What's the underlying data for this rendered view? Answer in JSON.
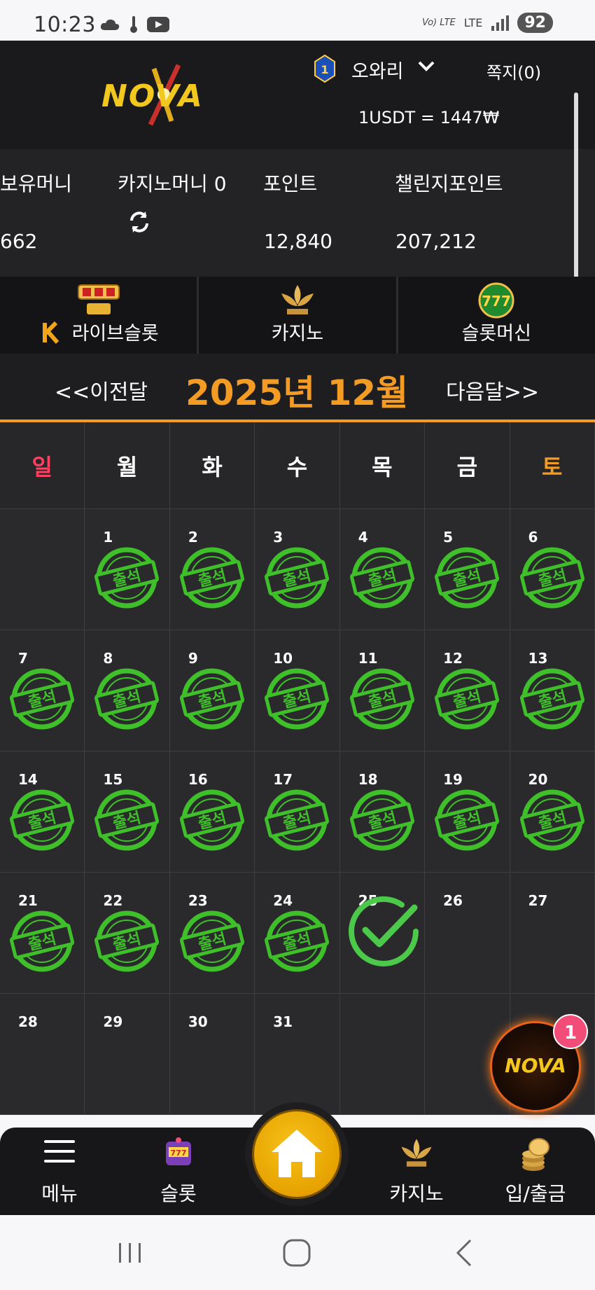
{
  "status_bar": {
    "time": "10:23",
    "battery": "92",
    "network": "LTE",
    "volte": "Vo) LTE"
  },
  "header": {
    "logo": "NOVA",
    "user_name": "오와리",
    "message": "쪽지(0)",
    "rate": "1USDT = 1447₩",
    "rank_level": "1"
  },
  "balances": {
    "holding_label": "보유머니",
    "holding_value": "662",
    "casino_label": "카지노머니 0",
    "point_label": "포인트",
    "point_value": "12,840",
    "challenge_label": "챌린지포인트",
    "challenge_value": "207,212"
  },
  "game_tabs": [
    "라이브슬롯",
    "카지노",
    "슬롯머신"
  ],
  "month_nav": {
    "prev": "<<이전달",
    "title": "2025년 12월",
    "next": "다음달>>"
  },
  "calendar": {
    "weekdays": [
      "일",
      "월",
      "화",
      "수",
      "목",
      "금",
      "토"
    ],
    "stamp_text": "출석",
    "weeks": [
      [
        {
          "d": "",
          "s": "none"
        },
        {
          "d": "1",
          "s": "stamp"
        },
        {
          "d": "2",
          "s": "stamp"
        },
        {
          "d": "3",
          "s": "stamp"
        },
        {
          "d": "4",
          "s": "stamp"
        },
        {
          "d": "5",
          "s": "stamp"
        },
        {
          "d": "6",
          "s": "stamp"
        }
      ],
      [
        {
          "d": "7",
          "s": "stamp"
        },
        {
          "d": "8",
          "s": "stamp"
        },
        {
          "d": "9",
          "s": "stamp"
        },
        {
          "d": "10",
          "s": "stamp"
        },
        {
          "d": "11",
          "s": "stamp"
        },
        {
          "d": "12",
          "s": "stamp"
        },
        {
          "d": "13",
          "s": "stamp"
        }
      ],
      [
        {
          "d": "14",
          "s": "stamp"
        },
        {
          "d": "15",
          "s": "stamp"
        },
        {
          "d": "16",
          "s": "stamp"
        },
        {
          "d": "17",
          "s": "stamp"
        },
        {
          "d": "18",
          "s": "stamp"
        },
        {
          "d": "19",
          "s": "stamp"
        },
        {
          "d": "20",
          "s": "stamp"
        }
      ],
      [
        {
          "d": "21",
          "s": "stamp"
        },
        {
          "d": "22",
          "s": "stamp"
        },
        {
          "d": "23",
          "s": "stamp"
        },
        {
          "d": "24",
          "s": "stamp"
        },
        {
          "d": "25",
          "s": "check"
        },
        {
          "d": "26",
          "s": "none"
        },
        {
          "d": "27",
          "s": "none"
        }
      ],
      [
        {
          "d": "28",
          "s": "none"
        },
        {
          "d": "29",
          "s": "none"
        },
        {
          "d": "30",
          "s": "none"
        },
        {
          "d": "31",
          "s": "none"
        },
        {
          "d": "",
          "s": "none"
        },
        {
          "d": "",
          "s": "none"
        },
        {
          "d": "",
          "s": "none"
        }
      ]
    ]
  },
  "floating": {
    "logo": "NOVA",
    "badge": "1"
  },
  "bottom_nav": {
    "menu": "메뉴",
    "slot": "슬롯",
    "casino": "카지노",
    "deposit": "입/출금"
  },
  "colors": {
    "accent": "#f39b22",
    "stamp_green": "#3fbf2a",
    "sunday": "#ff4060",
    "saturday": "#f39b22",
    "header_bg": "#1a1a1c"
  },
  "icons": [
    "cloud-icon",
    "thermometer-icon",
    "youtube-icon",
    "signal-icon",
    "refresh-icon",
    "chevron-down-icon",
    "home-icon",
    "hamburger-icon",
    "slot-machine-icon",
    "coins-icon"
  ]
}
